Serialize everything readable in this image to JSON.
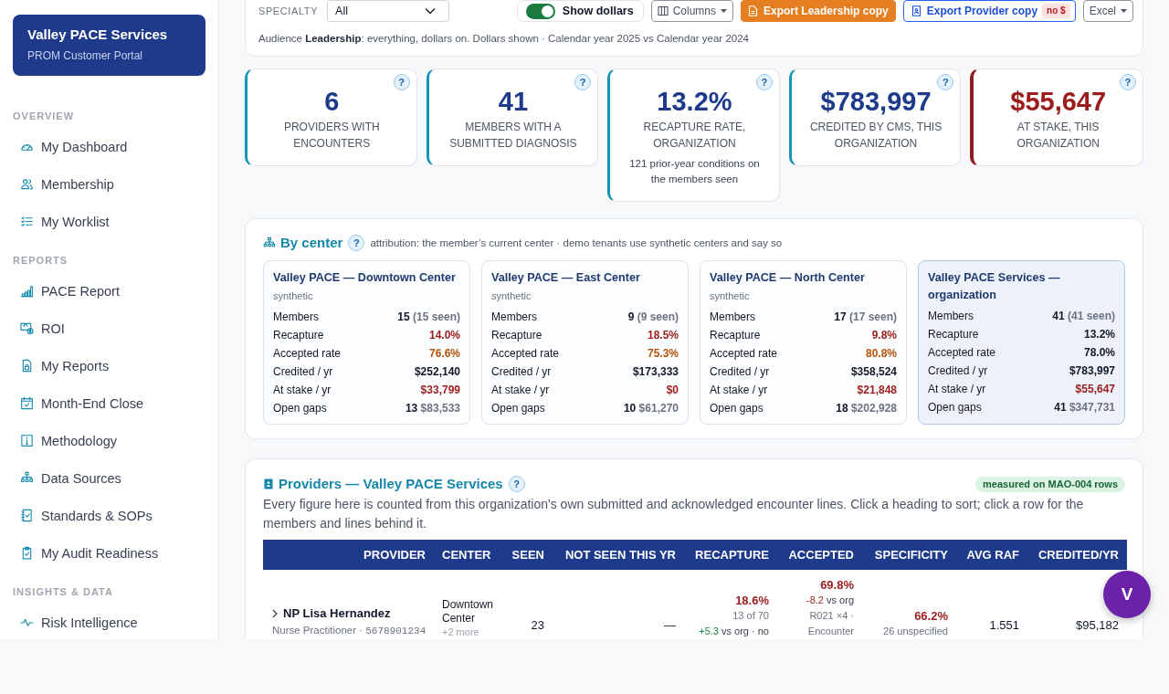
{
  "sidebar": {
    "brand": {
      "title": "Valley PACE Services",
      "subtitle": "PROM Customer Portal"
    },
    "sections": [
      {
        "label": "OVERVIEW",
        "items": [
          {
            "label": "My Dashboard",
            "selected": false
          },
          {
            "label": "Membership",
            "selected": false
          },
          {
            "label": "My Worklist",
            "selected": false
          }
        ]
      },
      {
        "label": "REPORTS",
        "items": [
          {
            "label": "PACE Report",
            "selected": false
          },
          {
            "label": "ROI",
            "selected": false
          },
          {
            "label": "My Reports",
            "selected": false
          },
          {
            "label": "Month-End Close",
            "selected": false
          },
          {
            "label": "Methodology",
            "selected": false
          },
          {
            "label": "Data Sources",
            "selected": false
          },
          {
            "label": "Standards & SOPs",
            "selected": false
          },
          {
            "label": "My Audit Readiness",
            "selected": false
          }
        ]
      },
      {
        "label": "INSIGHTS & DATA",
        "items": [
          {
            "label": "Risk Intelligence",
            "selected": false
          }
        ]
      }
    ]
  },
  "filters": {
    "specialty": {
      "label": "SPECIALTY",
      "value": "All"
    },
    "show_dollars": {
      "label": "Show dollars",
      "on": true
    },
    "buttons": [
      {
        "label": "Columns",
        "kind": "menu"
      },
      {
        "label": "Export Leadership copy",
        "kind": "primary"
      },
      {
        "label": "Export Provider copy",
        "kind": "outline",
        "badge": "no $"
      },
      {
        "label": "Excel",
        "kind": "menu"
      }
    ],
    "audience": "Audience **Leadership**: everything, dollars on. Dollars shown · Calendar year 2025 vs Calendar year 2024"
  },
  "kpis": [
    {
      "value": "6",
      "label": "PROVIDERS WITH ENCOUNTERS",
      "help": "?",
      "kind": "metric"
    },
    {
      "value": "41",
      "label": "MEMBERS WITH A SUBMITTED DIAGNOSIS",
      "help": "?",
      "kind": "metric"
    },
    {
      "value": "13.2%",
      "label": "RECAPTURE RATE, ORGANIZATION",
      "note": "121 prior-year conditions on the members seen",
      "help": "?",
      "kind": "metric"
    },
    {
      "value": "$783,997",
      "label": "CREDITED BY CMS, THIS ORGANIZATION",
      "help": "?",
      "kind": "metric"
    },
    {
      "value": "$55,647",
      "label": "AT STAKE, THIS ORGANIZATION",
      "help": "?",
      "kind": "risk"
    }
  ],
  "by_center": {
    "title": "By center",
    "help": "?",
    "note": "attribution: the member’s current center · demo tenants use synthetic centers and say so",
    "centers": [
      {
        "name": "Valley PACE — Downtown Center",
        "tag": "synthetic",
        "kind": "center",
        "rows": [
          {
            "label": "Members",
            "value": "15",
            "extra": "(15 seen)",
            "kind": "plain"
          },
          {
            "label": "Recapture",
            "value": "14.0%",
            "kind": "alert"
          },
          {
            "label": "Accepted rate",
            "value": "76.6%",
            "kind": "caution"
          },
          {
            "label": "Credited / yr",
            "value": "$252,140",
            "kind": "plain"
          },
          {
            "label": "At stake / yr",
            "value": "$33,799",
            "kind": "alert"
          },
          {
            "label": "Open gaps",
            "value": "13",
            "extra": "$83,533",
            "kind": "plain"
          }
        ]
      },
      {
        "name": "Valley PACE — East Center",
        "tag": "synthetic",
        "kind": "center",
        "rows": [
          {
            "label": "Members",
            "value": "9",
            "extra": "(9 seen)",
            "kind": "plain"
          },
          {
            "label": "Recapture",
            "value": "18.5%",
            "kind": "alert"
          },
          {
            "label": "Accepted rate",
            "value": "75.3%",
            "kind": "caution"
          },
          {
            "label": "Credited / yr",
            "value": "$173,333",
            "kind": "plain"
          },
          {
            "label": "At stake / yr",
            "value": "$0",
            "kind": "alert"
          },
          {
            "label": "Open gaps",
            "value": "10",
            "extra": "$61,270",
            "kind": "plain"
          }
        ]
      },
      {
        "name": "Valley PACE — North Center",
        "tag": "synthetic",
        "kind": "center",
        "rows": [
          {
            "label": "Members",
            "value": "17",
            "extra": "(17 seen)",
            "kind": "plain"
          },
          {
            "label": "Recapture",
            "value": "9.8%",
            "kind": "alert"
          },
          {
            "label": "Accepted rate",
            "value": "80.8%",
            "kind": "caution"
          },
          {
            "label": "Credited / yr",
            "value": "$358,524",
            "kind": "plain"
          },
          {
            "label": "At stake / yr",
            "value": "$21,848",
            "kind": "alert"
          },
          {
            "label": "Open gaps",
            "value": "18",
            "extra": "$202,928",
            "kind": "plain"
          }
        ]
      },
      {
        "name": "Valley PACE Services — organization",
        "kind": "organization",
        "rows": [
          {
            "label": "Members",
            "value": "41",
            "extra": "(41 seen)",
            "kind": "plain"
          },
          {
            "label": "Recapture",
            "value": "13.2%",
            "kind": "plain"
          },
          {
            "label": "Accepted rate",
            "value": "78.0%",
            "kind": "plain"
          },
          {
            "label": "Credited / yr",
            "value": "$783,997",
            "kind": "plain"
          },
          {
            "label": "At stake / yr",
            "value": "$55,647",
            "kind": "alert"
          },
          {
            "label": "Open gaps",
            "value": "41",
            "extra": "$347,731",
            "kind": "plain"
          }
        ]
      }
    ]
  },
  "providers": {
    "title": "Providers — Valley PACE Services",
    "help": "?",
    "badge": "measured on MAO-004 rows",
    "description": "Every figure here is counted from this organization's own submitted and acknowledged encounter lines. Click a heading to sort; click a row for the members and lines behind it.",
    "columns": [
      "PROVIDER",
      "CENTER",
      "SEEN",
      "NOT SEEN THIS YR",
      "RECAPTURE",
      "ACCEPTED",
      "SPECIFICITY",
      "AVG RAF",
      "CREDITED/YR"
    ],
    "rows": [
      {
        "expanded": false,
        "name": "NP Lisa Hernandez",
        "role": "Nurse Practitioner ·",
        "npi": "5678901234",
        "center": "Downtown Center",
        "center_more": "+2 more",
        "seen": "23",
        "not_seen": "—",
        "recapture": {
          "value": "18.6%",
          "kind": "alert",
          "detail": "13 of 70",
          "delta": {
            "text": "+5.3",
            "kind": "gain"
          },
          "delta_note": "vs org · no"
        },
        "accepted": {
          "value": "69.8%",
          "kind": "alert",
          "delta": {
            "text": "-8.2",
            "kind": "loss"
          },
          "delta_note": "vs org",
          "detail": "R021 ×4 · Encounter"
        },
        "specificity": {
          "value": "66.2%",
          "kind": "alert",
          "detail": "26 unspecified"
        },
        "avg_raf": "1.551",
        "credited": "$95,182"
      }
    ]
  },
  "assistant": {
    "initial": "V"
  }
}
